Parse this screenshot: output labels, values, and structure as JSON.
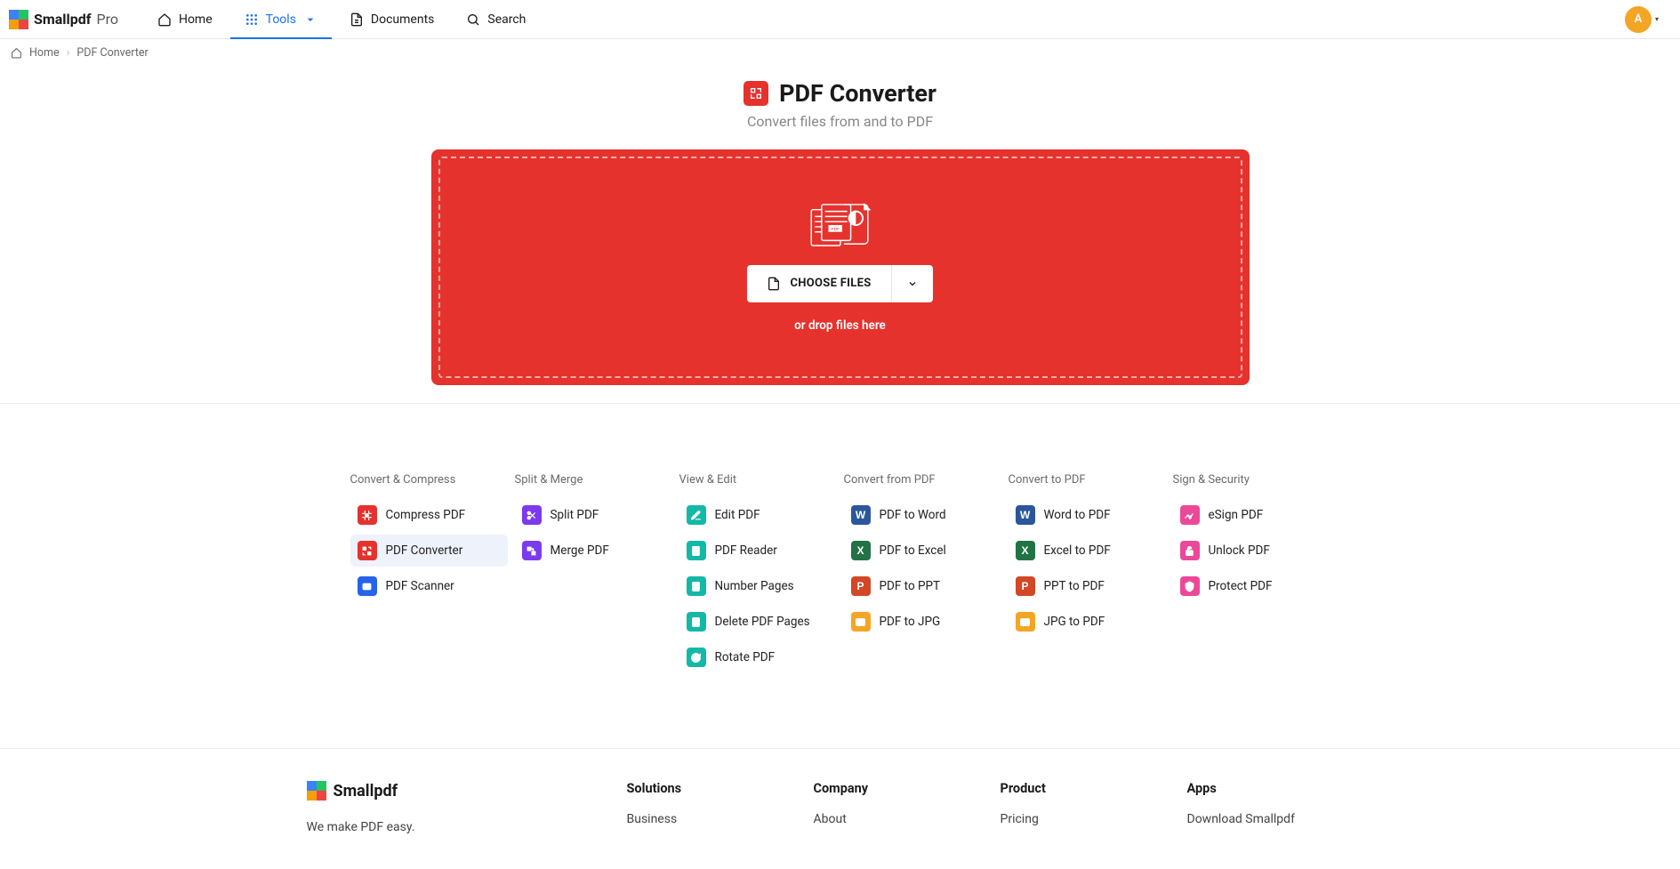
{
  "brand": {
    "name": "Smallpdf",
    "tier": "Pro"
  },
  "nav": {
    "home": "Home",
    "tools": "Tools",
    "documents": "Documents",
    "search": "Search"
  },
  "avatar": {
    "initial": "A"
  },
  "breadcrumbs": {
    "home": "Home",
    "current": "PDF Converter"
  },
  "hero": {
    "title": "PDF Converter",
    "subtitle": "Convert files from and to PDF"
  },
  "dropzone": {
    "choose": "CHOOSE FILES",
    "hint": "or drop files here"
  },
  "tool_columns": [
    {
      "title": "Convert & Compress",
      "items": [
        {
          "label": "Compress PDF",
          "color": "red",
          "icon": "compress"
        },
        {
          "label": "PDF Converter",
          "color": "red",
          "icon": "convert",
          "selected": true
        },
        {
          "label": "PDF Scanner",
          "color": "blue",
          "icon": "scan"
        }
      ]
    },
    {
      "title": "Split & Merge",
      "items": [
        {
          "label": "Split PDF",
          "color": "purple",
          "icon": "split"
        },
        {
          "label": "Merge PDF",
          "color": "purple",
          "icon": "merge"
        }
      ]
    },
    {
      "title": "View & Edit",
      "items": [
        {
          "label": "Edit PDF",
          "color": "teal",
          "icon": "edit"
        },
        {
          "label": "PDF Reader",
          "color": "teal",
          "icon": "reader"
        },
        {
          "label": "Number Pages",
          "color": "teal",
          "icon": "number"
        },
        {
          "label": "Delete PDF Pages",
          "color": "teal",
          "icon": "delete"
        },
        {
          "label": "Rotate PDF",
          "color": "teal",
          "icon": "rotate"
        }
      ]
    },
    {
      "title": "Convert from PDF",
      "items": [
        {
          "label": "PDF to Word",
          "color": "blueW",
          "icon": "W"
        },
        {
          "label": "PDF to Excel",
          "color": "greenX",
          "icon": "X"
        },
        {
          "label": "PDF to PPT",
          "color": "orangeP",
          "icon": "P"
        },
        {
          "label": "PDF to JPG",
          "color": "yellow",
          "icon": "jpg"
        }
      ]
    },
    {
      "title": "Convert to PDF",
      "items": [
        {
          "label": "Word to PDF",
          "color": "blueW",
          "icon": "W"
        },
        {
          "label": "Excel to PDF",
          "color": "greenX",
          "icon": "X"
        },
        {
          "label": "PPT to PDF",
          "color": "orangeP",
          "icon": "P"
        },
        {
          "label": "JPG to PDF",
          "color": "yellow",
          "icon": "jpg"
        }
      ]
    },
    {
      "title": "Sign & Security",
      "items": [
        {
          "label": "eSign PDF",
          "color": "pink",
          "icon": "sign"
        },
        {
          "label": "Unlock PDF",
          "color": "pink",
          "icon": "unlock"
        },
        {
          "label": "Protect PDF",
          "color": "pink",
          "icon": "protect"
        }
      ]
    }
  ],
  "footer": {
    "brand": "Smallpdf",
    "tagline": "We make PDF easy.",
    "cols": [
      {
        "title": "Solutions",
        "links": [
          "Business"
        ]
      },
      {
        "title": "Company",
        "links": [
          "About"
        ]
      },
      {
        "title": "Product",
        "links": [
          "Pricing"
        ]
      },
      {
        "title": "Apps",
        "links": [
          "Download Smallpdf"
        ]
      }
    ]
  }
}
